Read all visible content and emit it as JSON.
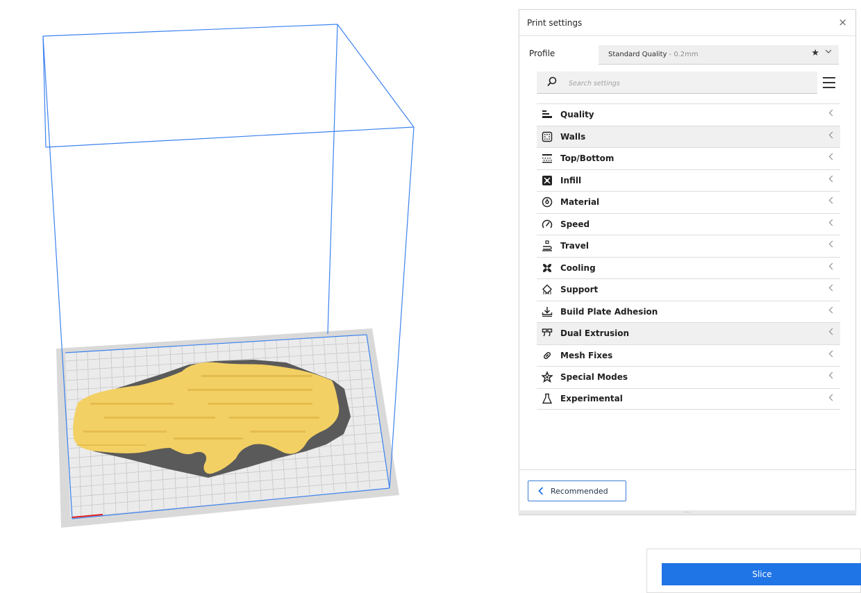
{
  "print_settings": {
    "title": "Print settings",
    "close_label": "×",
    "profile_label": "Profile",
    "profile_value": "Standard Quality",
    "profile_sub": "- 0.2mm",
    "search_placeholder": "Search settings",
    "categories": [
      {
        "label": "Quality",
        "icon": "quality-icon"
      },
      {
        "label": "Walls",
        "icon": "walls-icon"
      },
      {
        "label": "Top/Bottom",
        "icon": "top-bottom-icon"
      },
      {
        "label": "Infill",
        "icon": "infill-icon"
      },
      {
        "label": "Material",
        "icon": "material-icon"
      },
      {
        "label": "Speed",
        "icon": "speed-icon"
      },
      {
        "label": "Travel",
        "icon": "travel-icon"
      },
      {
        "label": "Cooling",
        "icon": "cooling-icon"
      },
      {
        "label": "Support",
        "icon": "support-icon"
      },
      {
        "label": "Build Plate Adhesion",
        "icon": "build-plate-adhesion-icon"
      },
      {
        "label": "Dual Extrusion",
        "icon": "dual-extrusion-icon"
      },
      {
        "label": "Mesh Fixes",
        "icon": "mesh-fixes-icon"
      },
      {
        "label": "Special Modes",
        "icon": "special-modes-icon"
      },
      {
        "label": "Experimental",
        "icon": "experimental-icon"
      }
    ],
    "recommended_label": "Recommended",
    "resize_label": "····"
  },
  "slice": {
    "button_label": "Slice"
  },
  "colors": {
    "accent": "#1f74e6",
    "build_volume_lines": "#3c82f0",
    "model_fill": "#f5d266",
    "model_shadow": "#555555",
    "build_plate": "#e6e6e6"
  }
}
